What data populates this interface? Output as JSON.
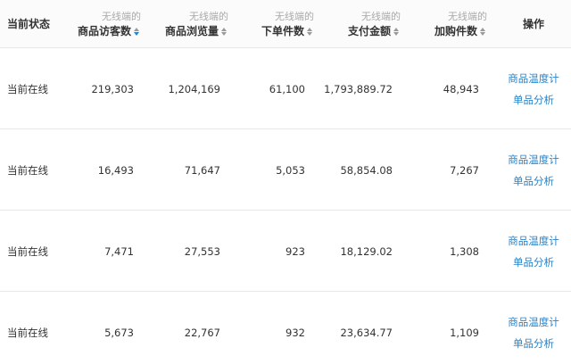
{
  "header": {
    "status": "当前状态",
    "columns": [
      {
        "sub": "无线端的",
        "main": "商品访客数",
        "sort_active": true
      },
      {
        "sub": "无线端的",
        "main": "商品浏览量",
        "sort_active": false
      },
      {
        "sub": "无线端的",
        "main": "下单件数",
        "sort_active": false
      },
      {
        "sub": "无线端的",
        "main": "支付金额",
        "sort_active": false
      },
      {
        "sub": "无线端的",
        "main": "加购件数",
        "sort_active": false
      }
    ],
    "ops": "操作"
  },
  "rows": [
    {
      "status": "当前在线",
      "visitors": "219,303",
      "views": "1,204,169",
      "orders": "61,100",
      "payment": "1,793,889.72",
      "cart": "48,943",
      "op1": "商品温度计",
      "op2": "单品分析"
    },
    {
      "status": "当前在线",
      "visitors": "16,493",
      "views": "71,647",
      "orders": "5,053",
      "payment": "58,854.08",
      "cart": "7,267",
      "op1": "商品温度计",
      "op2": "单品分析"
    },
    {
      "status": "当前在线",
      "visitors": "7,471",
      "views": "27,553",
      "orders": "923",
      "payment": "18,129.02",
      "cart": "1,308",
      "op1": "商品温度计",
      "op2": "单品分析"
    },
    {
      "status": "当前在线",
      "visitors": "5,673",
      "views": "22,767",
      "orders": "932",
      "payment": "23,634.77",
      "cart": "1,109",
      "op1": "商品温度计",
      "op2": "单品分析"
    }
  ],
  "colors": {
    "link": "#2b83c7",
    "border": "#e8e8e8",
    "sub_text": "#aaaaaa"
  }
}
